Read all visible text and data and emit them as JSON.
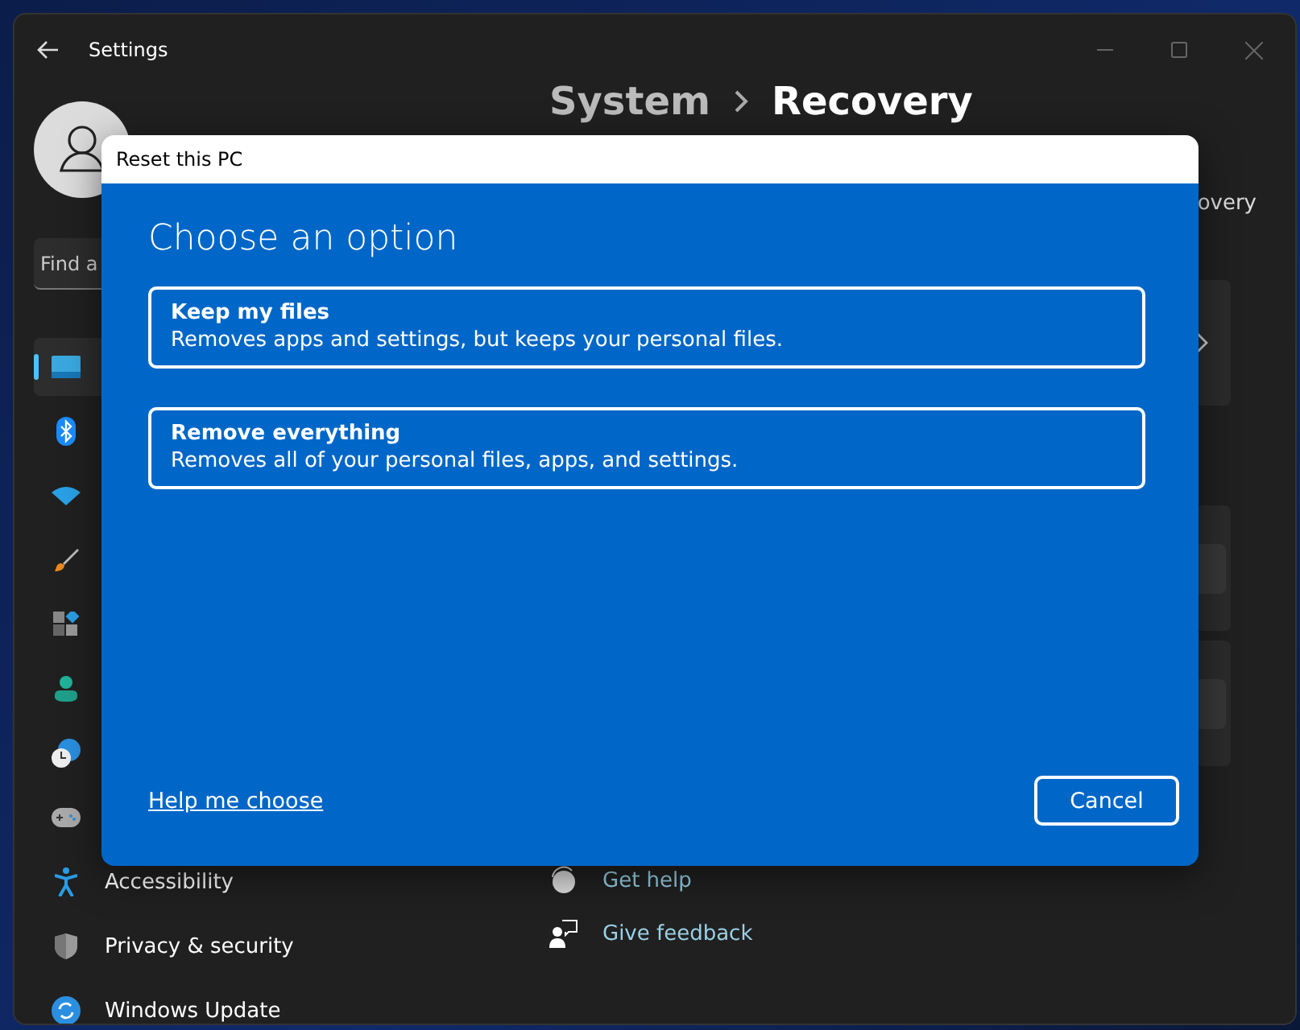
{
  "window": {
    "title": "Settings"
  },
  "sidebar": {
    "search": {
      "placeholder": "Find a"
    },
    "items": [
      {
        "selected": true
      },
      {
        "selected": false
      },
      {
        "selected": false
      },
      {
        "selected": false
      },
      {
        "selected": false
      },
      {
        "selected": false
      },
      {
        "selected": false
      },
      {
        "selected": false
      },
      {
        "label": "Accessibility",
        "selected": false
      },
      {
        "label": "Privacy & security",
        "selected": false
      },
      {
        "label": "Windows Update",
        "selected": false
      }
    ]
  },
  "content": {
    "breadcrumb": [
      "System",
      "Recovery"
    ],
    "subtitle": "overy",
    "cards": [
      {
        "kind": "link"
      },
      {
        "kind": "button"
      },
      {
        "kind": "button"
      }
    ],
    "related": [
      "Get help",
      "Give feedback"
    ]
  },
  "dialog": {
    "title": "Reset this PC",
    "heading": "Choose an option",
    "options": [
      {
        "title": "Keep my files",
        "description": "Removes apps and settings, but keeps your personal files."
      },
      {
        "title": "Remove everything",
        "description": "Removes all of your personal files, apps, and settings."
      }
    ],
    "help_link": "Help me choose",
    "buttons": [
      "Cancel"
    ]
  }
}
